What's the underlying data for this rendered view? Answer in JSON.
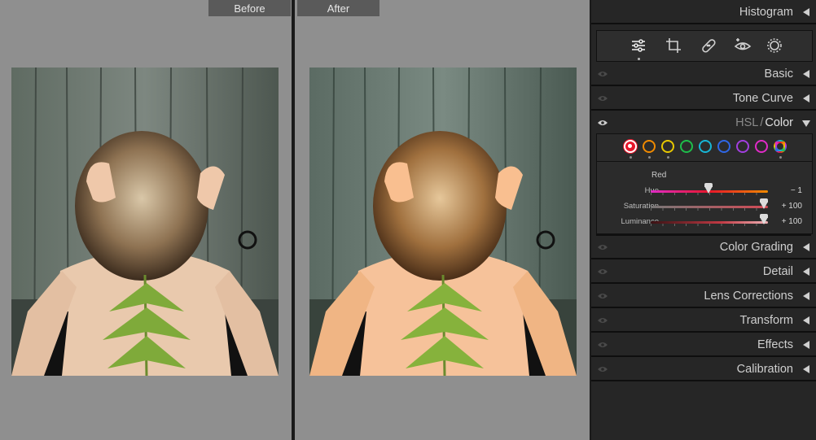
{
  "compare": {
    "before_label": "Before",
    "after_label": "After"
  },
  "panel": {
    "histogram_title": "Histogram",
    "toolbar_tools": [
      "edit-sliders-icon",
      "crop-icon",
      "healing-bandage-icon",
      "red-eye-icon",
      "masking-icon"
    ],
    "sections": {
      "basic": "Basic",
      "tone_curve": "Tone Curve",
      "hsl_prefix": "HSL",
      "hsl_divider": "/",
      "color": "Color",
      "color_grading": "Color Grading",
      "detail": "Detail",
      "lens_corrections": "Lens Corrections",
      "transform": "Transform",
      "effects": "Effects",
      "calibration": "Calibration"
    },
    "hsl": {
      "swatch_colors": [
        "#e8162a",
        "#f08a00",
        "#e8c800",
        "#1ebd4a",
        "#17b6d6",
        "#2f67e6",
        "#a23fe0",
        "#e02bc7"
      ],
      "selected_group": "Red",
      "hue": {
        "label": "Hue",
        "value": -1,
        "display": "− 1"
      },
      "saturation": {
        "label": "Saturation",
        "value": 100,
        "display": "+ 100"
      },
      "luminance": {
        "label": "Luminance",
        "value": 100,
        "display": "+ 100"
      }
    }
  }
}
